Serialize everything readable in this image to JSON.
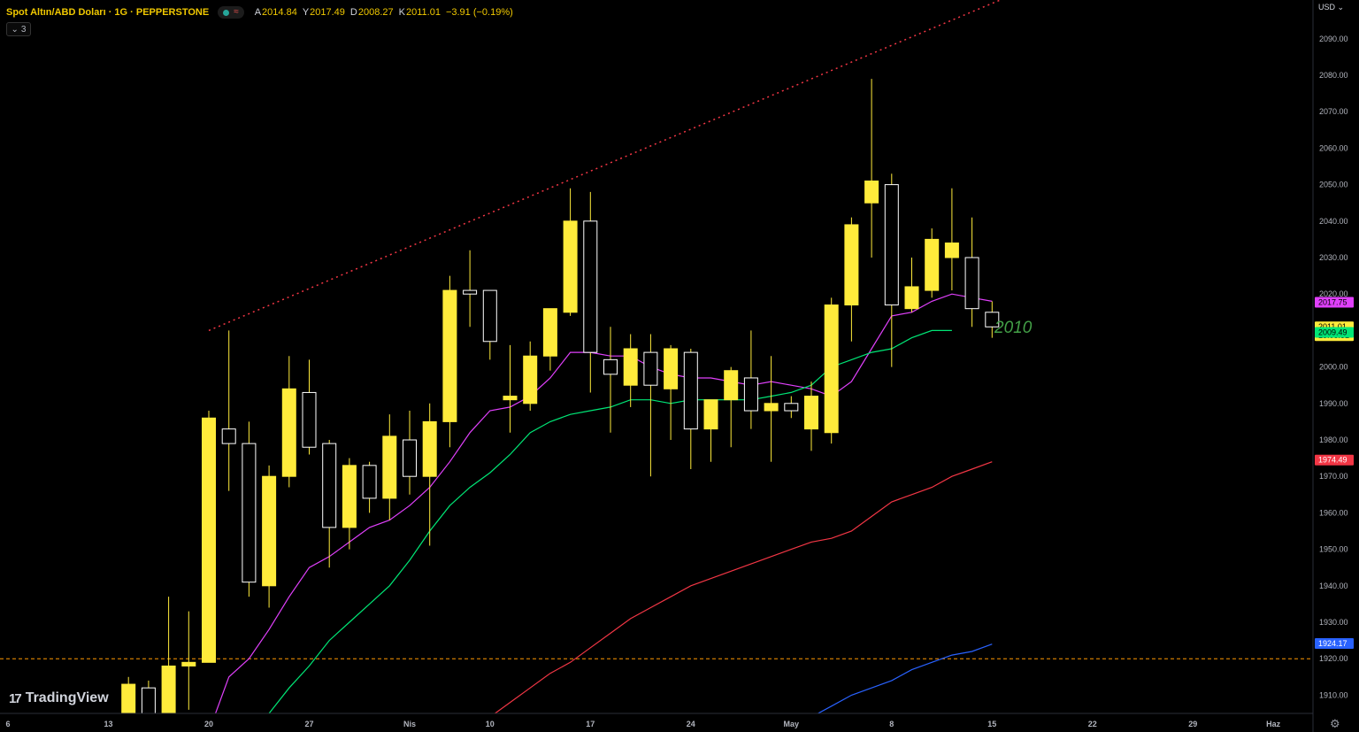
{
  "header": {
    "symbol": "Spot Altın/ABD Doları · 1G · PEPPERSTONE",
    "open_label": "A",
    "open": "2014.84",
    "high_label": "Y",
    "high": "2017.49",
    "low_label": "D",
    "low": "2008.27",
    "close_label": "K",
    "close": "2011.01",
    "change": "−3.91 (−0.19%)",
    "indicator_count": "3"
  },
  "axis": {
    "currency": "USD"
  },
  "annotation": {
    "text": "2010"
  },
  "logo": {
    "text": "TradingView"
  },
  "colors": {
    "bull": "#ffeb3b",
    "bear": "#000000",
    "bear_border": "#ffffff",
    "wick": "#ffeb3b",
    "ma_magenta": "#e040fb",
    "ma_green": "#00e676",
    "ma_red": "#f23645",
    "ma_blue": "#2962ff",
    "trendline": "#f23645",
    "level": "#ff9800",
    "annotation": "#43a047"
  },
  "chart_data": {
    "type": "candlestick",
    "timeframe": "1D",
    "ylim": [
      1905,
      2100
    ],
    "y_ticks": [
      1910,
      1920,
      1930,
      1940,
      1950,
      1960,
      1970,
      1980,
      1990,
      2000,
      2010,
      2020,
      2030,
      2040,
      2050,
      2060,
      2070,
      2080,
      2090
    ],
    "x_tick_labels": [
      {
        "label": "6",
        "index": -6
      },
      {
        "label": "13",
        "index": -1
      },
      {
        "label": "20",
        "index": 4
      },
      {
        "label": "27",
        "index": 9
      },
      {
        "label": "Nis",
        "index": 14
      },
      {
        "label": "10",
        "index": 18
      },
      {
        "label": "17",
        "index": 23
      },
      {
        "label": "24",
        "index": 28
      },
      {
        "label": "May",
        "index": 33
      },
      {
        "label": "8",
        "index": 38
      },
      {
        "label": "15",
        "index": 43
      },
      {
        "label": "22",
        "index": 48
      },
      {
        "label": "29",
        "index": 53
      },
      {
        "label": "Haz",
        "index": 57
      }
    ],
    "candles": [
      {
        "o": 1904,
        "h": 1915,
        "l": 1904,
        "c": 1913
      },
      {
        "o": 1912,
        "h": 1914,
        "l": 1903,
        "c": 1904
      },
      {
        "o": 1903,
        "h": 1937,
        "l": 1902,
        "c": 1918
      },
      {
        "o": 1918,
        "h": 1933,
        "l": 1906,
        "c": 1919
      },
      {
        "o": 1919,
        "h": 1988,
        "l": 1919,
        "c": 1986
      },
      {
        "o": 1983,
        "h": 2010,
        "l": 1966,
        "c": 1979
      },
      {
        "o": 1979,
        "h": 1985,
        "l": 1937,
        "c": 1941
      },
      {
        "o": 1940,
        "h": 1973,
        "l": 1934,
        "c": 1970
      },
      {
        "o": 1970,
        "h": 2003,
        "l": 1967,
        "c": 1994
      },
      {
        "o": 1993,
        "h": 2002,
        "l": 1976,
        "c": 1978
      },
      {
        "o": 1979,
        "h": 1980,
        "l": 1945,
        "c": 1956
      },
      {
        "o": 1956,
        "h": 1975,
        "l": 1950,
        "c": 1973
      },
      {
        "o": 1973,
        "h": 1974,
        "l": 1960,
        "c": 1964
      },
      {
        "o": 1964,
        "h": 1987,
        "l": 1958,
        "c": 1981
      },
      {
        "o": 1980,
        "h": 1988,
        "l": 1965,
        "c": 1970
      },
      {
        "o": 1970,
        "h": 1990,
        "l": 1951,
        "c": 1985
      },
      {
        "o": 1985,
        "h": 2025,
        "l": 1978,
        "c": 2021
      },
      {
        "o": 2021,
        "h": 2032,
        "l": 2011,
        "c": 2020
      },
      {
        "o": 2021,
        "h": 2021,
        "l": 2002,
        "c": 2007
      },
      {
        "o": 1991,
        "h": 2006,
        "l": 1982,
        "c": 1992
      },
      {
        "o": 1990,
        "h": 2007,
        "l": 1988,
        "c": 2003
      },
      {
        "o": 2003,
        "h": 2009,
        "l": 1999,
        "c": 2016
      },
      {
        "o": 2015,
        "h": 2049,
        "l": 2014,
        "c": 2040
      },
      {
        "o": 2040,
        "h": 2048,
        "l": 1993,
        "c": 2004
      },
      {
        "o": 2002,
        "h": 2011,
        "l": 1982,
        "c": 1998
      },
      {
        "o": 1995,
        "h": 2009,
        "l": 1989,
        "c": 2005
      },
      {
        "o": 2004,
        "h": 2009,
        "l": 1970,
        "c": 1995
      },
      {
        "o": 1994,
        "h": 2006,
        "l": 1980,
        "c": 2005
      },
      {
        "o": 2004,
        "h": 2005,
        "l": 1972,
        "c": 1983
      },
      {
        "o": 1983,
        "h": 1990,
        "l": 1974,
        "c": 1991
      },
      {
        "o": 1991,
        "h": 2000,
        "l": 1978,
        "c": 1999
      },
      {
        "o": 1997,
        "h": 2010,
        "l": 1983,
        "c": 1988
      },
      {
        "o": 1988,
        "h": 2003,
        "l": 1974,
        "c": 1990
      },
      {
        "o": 1990,
        "h": 1992,
        "l": 1986,
        "c": 1988
      },
      {
        "o": 1983,
        "h": 1996,
        "l": 1977,
        "c": 1992
      },
      {
        "o": 1982,
        "h": 2019,
        "l": 1979,
        "c": 2017
      },
      {
        "o": 2017,
        "h": 2041,
        "l": 2007,
        "c": 2039
      },
      {
        "o": 2045,
        "h": 2079,
        "l": 2030,
        "c": 2051
      },
      {
        "o": 2050,
        "h": 2053,
        "l": 2000,
        "c": 2017
      },
      {
        "o": 2016,
        "h": 2030,
        "l": 2015,
        "c": 2022
      },
      {
        "o": 2021,
        "h": 2038,
        "l": 2019,
        "c": 2035
      },
      {
        "o": 2030,
        "h": 2049,
        "l": 2021,
        "c": 2034
      },
      {
        "o": 2030,
        "h": 2041,
        "l": 2011,
        "c": 2016
      },
      {
        "o": 2015,
        "h": 2018,
        "l": 2008,
        "c": 2011
      }
    ],
    "moving_averages": [
      {
        "color_key": "ma_magenta",
        "start_index": 4,
        "values": [
          1900,
          1915,
          1920,
          1928,
          1937,
          1945,
          1948,
          1952,
          1956,
          1958,
          1962,
          1967,
          1974,
          1982,
          1988,
          1989,
          1992,
          1997,
          2004,
          2004,
          2003,
          2003,
          2000,
          1998,
          1997,
          1997,
          1996,
          1995,
          1996,
          1995,
          1994,
          1992,
          1996,
          2005,
          2014,
          2015,
          2018,
          2020,
          2019,
          2018
        ]
      },
      {
        "color_key": "ma_green",
        "start_index": 7,
        "values": [
          1905,
          1912,
          1918,
          1925,
          1930,
          1935,
          1940,
          1947,
          1955,
          1962,
          1967,
          1971,
          1976,
          1982,
          1985,
          1987,
          1988,
          1989,
          1991,
          1991,
          1990,
          1991,
          1991,
          1991,
          1991,
          1992,
          1993,
          1995,
          2000,
          2002,
          2004,
          2005,
          2008,
          2010,
          2010
        ]
      },
      {
        "color_key": "ma_red",
        "start_index": 18,
        "values": [
          1904,
          1908,
          1912,
          1916,
          1919,
          1923,
          1927,
          1931,
          1934,
          1937,
          1940,
          1942,
          1944,
          1946,
          1948,
          1950,
          1952,
          1953,
          1955,
          1959,
          1963,
          1965,
          1967,
          1970,
          1972,
          1974
        ]
      },
      {
        "color_key": "ma_blue",
        "start_index": 34,
        "values": [
          1904,
          1907,
          1910,
          1912,
          1914,
          1917,
          1919,
          1921,
          1922,
          1924
        ]
      }
    ],
    "trendline": {
      "from_index": 4,
      "from_price": 2010,
      "to_index": 54,
      "to_price": 2125
    },
    "horizontal_level": 1920,
    "price_labels": [
      {
        "text": "2017.75",
        "price": 2017.75,
        "bg": "#e040fb",
        "fg": "#000000"
      },
      {
        "text": "2011.01",
        "subtext": "15:05:31",
        "price": 2011.01,
        "bg": "#ffeb3b",
        "fg": "#000000"
      },
      {
        "text": "2009.49",
        "price": 2009.49,
        "bg": "#00e676",
        "fg": "#000000"
      },
      {
        "text": "1974.49",
        "price": 1974.49,
        "bg": "#f23645",
        "fg": "#ffffff"
      },
      {
        "text": "1924.17",
        "price": 1924.17,
        "bg": "#2962ff",
        "fg": "#ffffff"
      }
    ]
  }
}
